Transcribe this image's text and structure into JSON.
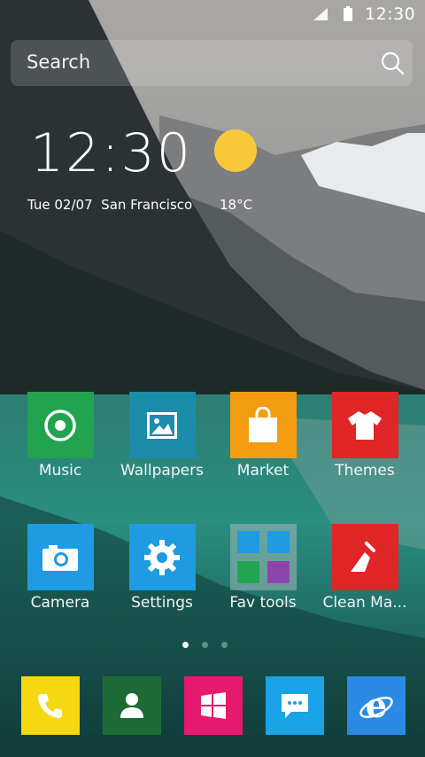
{
  "status_bar": {
    "time": "12:30"
  },
  "search": {
    "placeholder": "Search"
  },
  "clock_widget": {
    "time": "12:30",
    "date": "Tue  02/07",
    "city": "San Francisco",
    "temperature": "18°C",
    "weather_icon": "sun-icon"
  },
  "apps_row1": [
    {
      "label": "Music",
      "color": "#22a350",
      "icon": "music-icon"
    },
    {
      "label": "Wallpapers",
      "color": "#1b8caa",
      "icon": "image-icon"
    },
    {
      "label": "Market",
      "color": "#f39c12",
      "icon": "shopping-bag-icon"
    },
    {
      "label": "Themes",
      "color": "#e02626",
      "icon": "tshirt-icon"
    }
  ],
  "apps_row2": [
    {
      "label": "Camera",
      "color": "#1e9be2",
      "icon": "camera-icon"
    },
    {
      "label": "Settings",
      "color": "#1e9be2",
      "icon": "gear-icon"
    },
    {
      "label": "Fav tools",
      "color": "#8aa7a7",
      "icon": "folder-icon"
    },
    {
      "label": "Clean Ma...",
      "color": "#e02626",
      "icon": "broom-icon"
    }
  ],
  "page_indicator": {
    "pages": 3,
    "current": 1
  },
  "dock": [
    {
      "name": "phone",
      "color": "#f5d80f",
      "icon": "phone-icon"
    },
    {
      "name": "contacts",
      "color": "#1f6b38",
      "icon": "person-icon"
    },
    {
      "name": "store",
      "color": "#e5196d",
      "icon": "windows-icon"
    },
    {
      "name": "messages",
      "color": "#1aa3e6",
      "icon": "chat-icon"
    },
    {
      "name": "browser",
      "color": "#2b8ae4",
      "icon": "internet-explorer-icon"
    }
  ]
}
